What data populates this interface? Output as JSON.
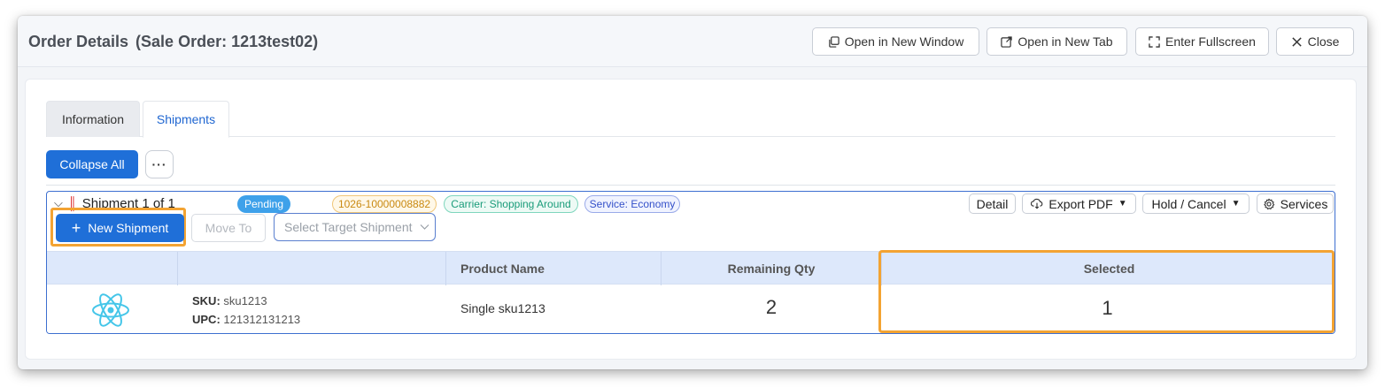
{
  "window": {
    "title": "Order Details",
    "subtitle": "(Sale Order: 1213test02)",
    "buttons": {
      "open_window": "Open in New Window",
      "open_tab": "Open in New Tab",
      "fullscreen": "Enter Fullscreen",
      "close": "Close"
    }
  },
  "tabs": [
    "Information",
    "Shipments"
  ],
  "active_tab": "Shipments",
  "toolbar": {
    "collapse_label": "Collapse All",
    "more_label": "···"
  },
  "shipment": {
    "title": "Shipment 1 of 1",
    "status": "Pending",
    "order_no": "1026-10000008882",
    "carrier": "Carrier: Shopping Around",
    "service": "Service: Economy",
    "actions": {
      "detail": "Detail",
      "export_pdf": "Export PDF",
      "hold_cancel": "Hold / Cancel",
      "services": "Services"
    },
    "new_shipment": "New Shipment",
    "move_to": "Move To",
    "select_target_placeholder": "Select Target Shipment",
    "columns": [
      "",
      "",
      "Product Name",
      "Remaining Qty",
      "Selected"
    ],
    "rows": [
      {
        "sku_label": "SKU:",
        "sku": "sku1213",
        "upc_label": "UPC:",
        "upc": "121312131213",
        "product_name": "Single sku1213",
        "remaining_qty": "2",
        "selected": "1"
      }
    ]
  },
  "colors": {
    "primary": "#1f6fd8",
    "highlight": "#f3a332",
    "pending": "#3ea1ea",
    "table_header": "#dde8fb"
  },
  "icons": [
    "copy-icon",
    "external-link-icon",
    "fullscreen-icon",
    "close-icon",
    "chevron-down-icon",
    "barcode-icon",
    "cloud-download-icon",
    "caret-down-icon",
    "gear-icon",
    "plus-icon",
    "react-logo-icon"
  ]
}
